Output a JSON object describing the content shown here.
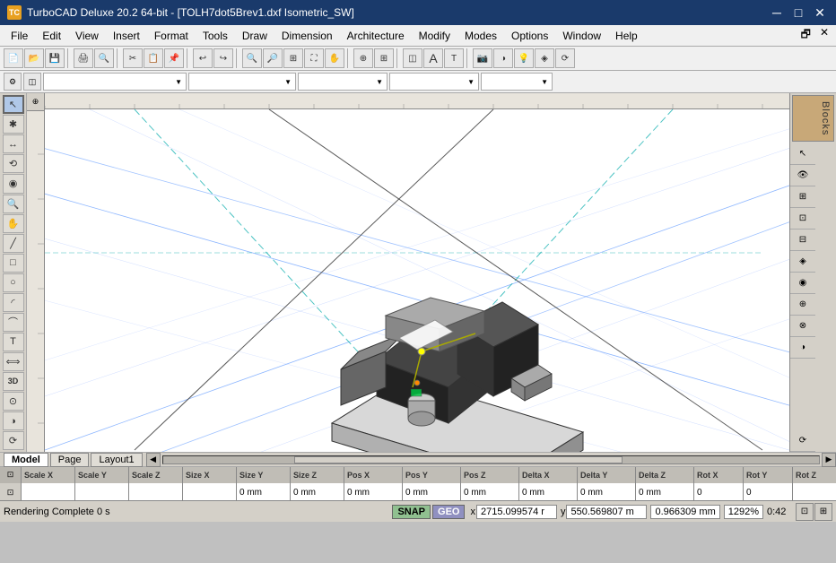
{
  "titlebar": {
    "title": "TurboCAD Deluxe 20.2 64-bit - [TOLH7dot5Brev1.dxf Isometric_SW]",
    "app_icon": "TC",
    "min_label": "─",
    "max_label": "□",
    "close_label": "✕"
  },
  "menubar": {
    "items": [
      "File",
      "Edit",
      "View",
      "Insert",
      "Format",
      "Tools",
      "Draw",
      "Dimension",
      "Architecture",
      "Modify",
      "Modes",
      "Options",
      "Window",
      "Help"
    ]
  },
  "toolbar": {
    "rows": [
      [
        "new",
        "open",
        "save",
        "print",
        "preview",
        "cut",
        "copy",
        "paste",
        "delete",
        "undo",
        "redo",
        "zoom-in",
        "zoom-out",
        "zoom-fit",
        "pan",
        "rotate",
        "measure",
        "text",
        "hatch",
        "snap-grid",
        "layers",
        "line-color",
        "fill-color",
        "camera",
        "render",
        "lights",
        "materials"
      ],
      [
        "dropdowns"
      ]
    ],
    "dropdowns": [
      "",
      "",
      "",
      "",
      ""
    ]
  },
  "left_toolbar": {
    "tools": [
      "↖",
      "↔",
      "✱",
      "⟲",
      "◉",
      "✚",
      "⊡",
      "⌀",
      "⌤",
      "☐",
      "✏",
      "📐",
      "📏",
      "⊿",
      "3D",
      "⊙",
      "✋",
      "⟳"
    ]
  },
  "canvas": {
    "bg_color": "#ffffff"
  },
  "right_panel": {
    "blocks_label": "Blocks",
    "icons": [
      "▣",
      "⊡",
      "⊞",
      "⊟",
      "⊠",
      "⊕",
      "⊗",
      "◈",
      "◉"
    ]
  },
  "tabs": {
    "items": [
      "Model",
      "Page",
      "Layout1"
    ],
    "active": "Model"
  },
  "statusbar": {
    "columns": [
      {
        "label": "Scale X",
        "value": ""
      },
      {
        "label": "Scale Y",
        "value": ""
      },
      {
        "label": "Scale Z",
        "value": ""
      },
      {
        "label": "Size X",
        "value": ""
      },
      {
        "label": "Size Y",
        "value": "0 mm"
      },
      {
        "label": "Size Z",
        "value": "0 mm"
      },
      {
        "label": "Pos X",
        "value": "0 mm"
      },
      {
        "label": "Pos Y",
        "value": "0 mm"
      },
      {
        "label": "Pos Z",
        "value": "0 mm"
      },
      {
        "label": "Delta X",
        "value": "0 mm"
      },
      {
        "label": "Delta Y",
        "value": "0 mm"
      },
      {
        "label": "Delta Z",
        "value": "0 mm"
      },
      {
        "label": "Rot X",
        "value": "0"
      },
      {
        "label": "Rot Y",
        "value": "0"
      },
      {
        "label": "Rot Z",
        "value": ""
      }
    ]
  },
  "bottombar": {
    "status": "Rendering Complete  0 s",
    "snap_label": "SNAP",
    "geo_label": "GEO",
    "coord_x": "2715.099574 r",
    "coord_y": "550.569807 m",
    "coord_z": "0.966309 mm",
    "zoom": "1292%",
    "time": "0:42",
    "icons": [
      "⊡",
      "⊞"
    ]
  }
}
